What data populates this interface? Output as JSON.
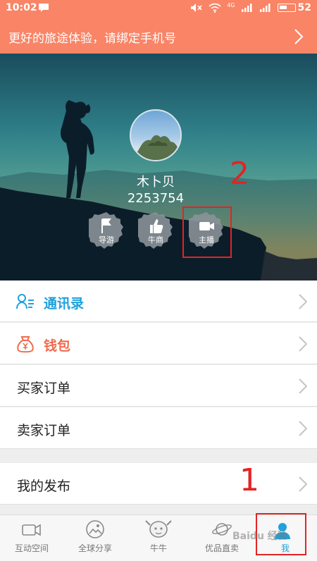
{
  "status_bar": {
    "time": "10:02",
    "network": "4G",
    "battery": "52",
    "icons": [
      "chat-icon",
      "mute-icon",
      "wifi-icon",
      "signal-icon",
      "signal-icon",
      "battery-icon"
    ]
  },
  "banner": {
    "text": "更好的旅途体验，请绑定手机号",
    "background": "#f98466"
  },
  "profile": {
    "name": "木卜贝",
    "id": "2253754",
    "badges": [
      {
        "label": "导游",
        "icon": "flag-icon"
      },
      {
        "label": "牛商",
        "icon": "thumbs-up-icon"
      },
      {
        "label": "主播",
        "icon": "video-camera-icon"
      }
    ]
  },
  "menu": [
    {
      "label": "通讯录",
      "icon": "contacts-icon",
      "color": "#1fa2dc"
    },
    {
      "label": "钱包",
      "icon": "wallet-icon",
      "color": "#f06b4d"
    },
    {
      "label": "买家订单"
    },
    {
      "label": "卖家订单"
    },
    {
      "label": "我的发布"
    }
  ],
  "tabs": [
    {
      "label": "互动空间",
      "icon": "video-camera-icon"
    },
    {
      "label": "全球分享",
      "icon": "globe-share-icon"
    },
    {
      "label": "牛牛",
      "icon": "mascot-icon"
    },
    {
      "label": "优品直卖",
      "icon": "planet-icon"
    },
    {
      "label": "我",
      "icon": "person-icon",
      "active": true
    }
  ],
  "annotations": {
    "step1": "1",
    "step2": "2"
  },
  "watermark": "Baidu 经验",
  "colors": {
    "accent": "#1fa2dc",
    "highlight": "#e52323"
  }
}
